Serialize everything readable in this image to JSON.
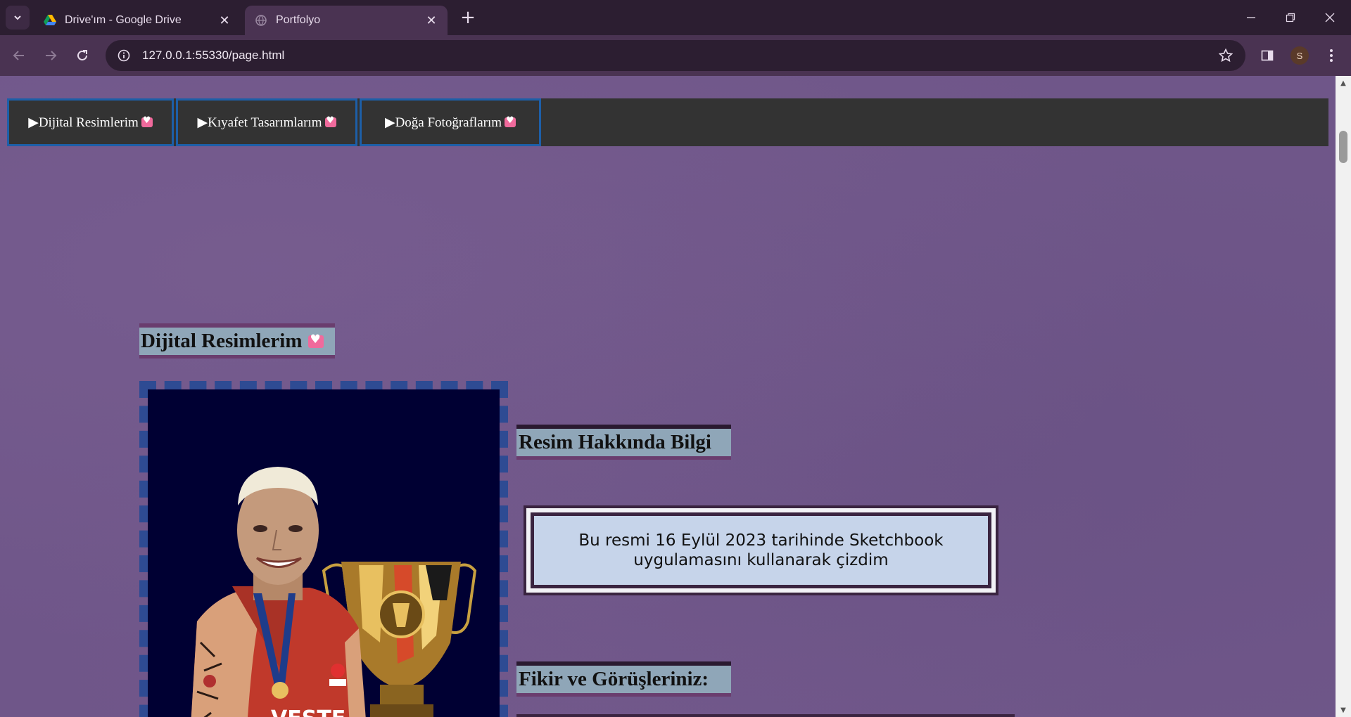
{
  "browser": {
    "tabs": [
      {
        "title": "Drive'ım - Google Drive",
        "icon": "google-drive-icon",
        "active": false
      },
      {
        "title": "Portfolyo",
        "icon": "globe-icon",
        "active": true
      }
    ],
    "url": "127.0.0.1:55330/page.html",
    "profile_initial": "S"
  },
  "page": {
    "nav": [
      {
        "label": "▶Dijital Resimlerim",
        "icon": "heart-icon"
      },
      {
        "label": "▶Kıyafet Tasarımlarım",
        "icon": "heart-icon"
      },
      {
        "label": "▶Doğa Fotoğraflarım",
        "icon": "heart-icon"
      }
    ],
    "section_title": "Dijital Resimlerim",
    "info_title": "Resim Hakkında Bilgi",
    "info_text": "Bu resmi 16 Eylül 2023 tarihinde Sketchbook uygulamasını kullanarak çizdim",
    "feedback_title": "Fikir ve Görüşleriniz:",
    "artwork_text": "VESTE"
  },
  "colors": {
    "page_background": "#6f5689",
    "nav_background": "#333333",
    "nav_border": "#1d5fa8",
    "heading_background": "#8fa6b8",
    "info_box_background": "#c6d4ea",
    "frame_dashes": "#2e4b93",
    "painting_background": "#000033"
  }
}
